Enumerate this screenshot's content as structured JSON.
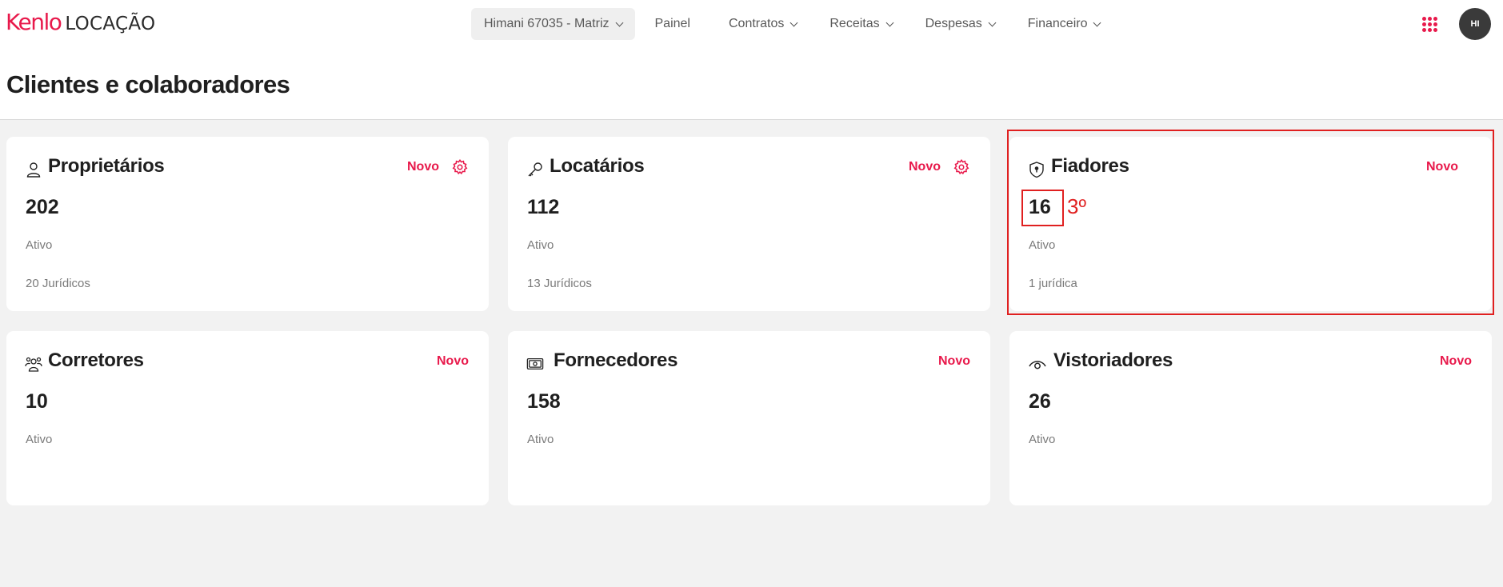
{
  "header": {
    "logo_brand": "Kenlo",
    "logo_product": "LOCAÇÃO",
    "branch": "Himani 67035 - Matriz",
    "nav": [
      "Painel",
      "Contratos",
      "Receitas",
      "Despesas",
      "Financeiro"
    ],
    "avatar_initials": "HI"
  },
  "page_title": "Clientes e colaboradores",
  "cards": [
    {
      "title": "Proprietários",
      "action": "Novo",
      "count": "202",
      "status": "Ativo",
      "sub": "20 Jurídicos",
      "icon": "person-icon",
      "has_settings": true
    },
    {
      "title": "Locatários",
      "action": "Novo",
      "count": "112",
      "status": "Ativo",
      "sub": "13 Jurídicos",
      "icon": "key-icon",
      "has_settings": true
    },
    {
      "title": "Fiadores",
      "action": "Novo",
      "count": "16",
      "status": "Ativo",
      "sub": "1 jurídica",
      "icon": "shield-icon",
      "has_settings": false
    },
    {
      "title": "Corretores",
      "action": "Novo",
      "count": "10",
      "status": "Ativo",
      "icon": "team-icon",
      "has_settings": false
    },
    {
      "title": "Fornecedores",
      "action": "Novo",
      "count": "158",
      "status": "Ativo",
      "icon": "money-icon",
      "has_settings": false
    },
    {
      "title": "Vistoriadores",
      "action": "Novo",
      "count": "26",
      "status": "Ativo",
      "icon": "eye-icon",
      "has_settings": false
    }
  ],
  "annotation": {
    "label": "3º",
    "color": "#e02020"
  },
  "colors": {
    "accent": "#e8194b",
    "background": "#f2f2f2",
    "card": "#ffffff"
  }
}
